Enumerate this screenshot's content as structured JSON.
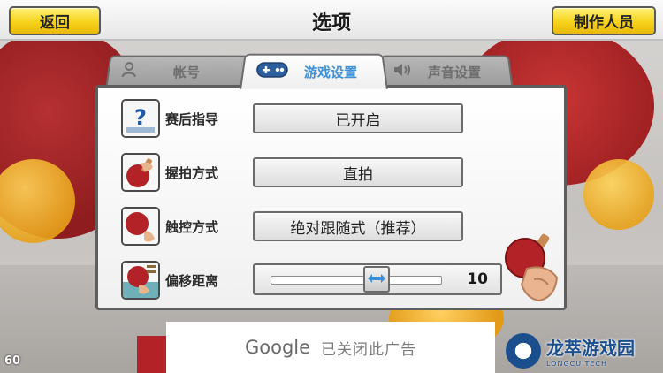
{
  "header": {
    "back_label": "返回",
    "title": "选项",
    "credits_label": "制作人员"
  },
  "tabs": [
    {
      "label": "帐号",
      "icon": "person-icon",
      "active": false
    },
    {
      "label": "游戏设置",
      "icon": "gamepad-icon",
      "active": true
    },
    {
      "label": "声音设置",
      "icon": "speaker-icon",
      "active": false
    }
  ],
  "settings": {
    "post_match_guide": {
      "label": "赛后指导",
      "icon": "question-icon",
      "value": "已开启"
    },
    "grip_style": {
      "label": "握拍方式",
      "icon": "paddle-grip-icon",
      "value": "直拍"
    },
    "touch_control": {
      "label": "触控方式",
      "icon": "paddle-touch-icon",
      "value": "绝对跟随式（推荐）"
    },
    "offset_distance": {
      "label": "偏移距离",
      "icon": "offset-icon",
      "value": "10",
      "slider_fraction": 0.62
    }
  },
  "ad": {
    "brand": "Google",
    "message": "已关闭此广告"
  },
  "fps": "60",
  "watermark": {
    "title": "龙萃游戏园",
    "subtitle": "LONGCUITECH"
  },
  "colors": {
    "accent_yellow": "#f6d21a",
    "active_tab_text": "#3b8fd6",
    "paddle_red": "#b22226"
  }
}
